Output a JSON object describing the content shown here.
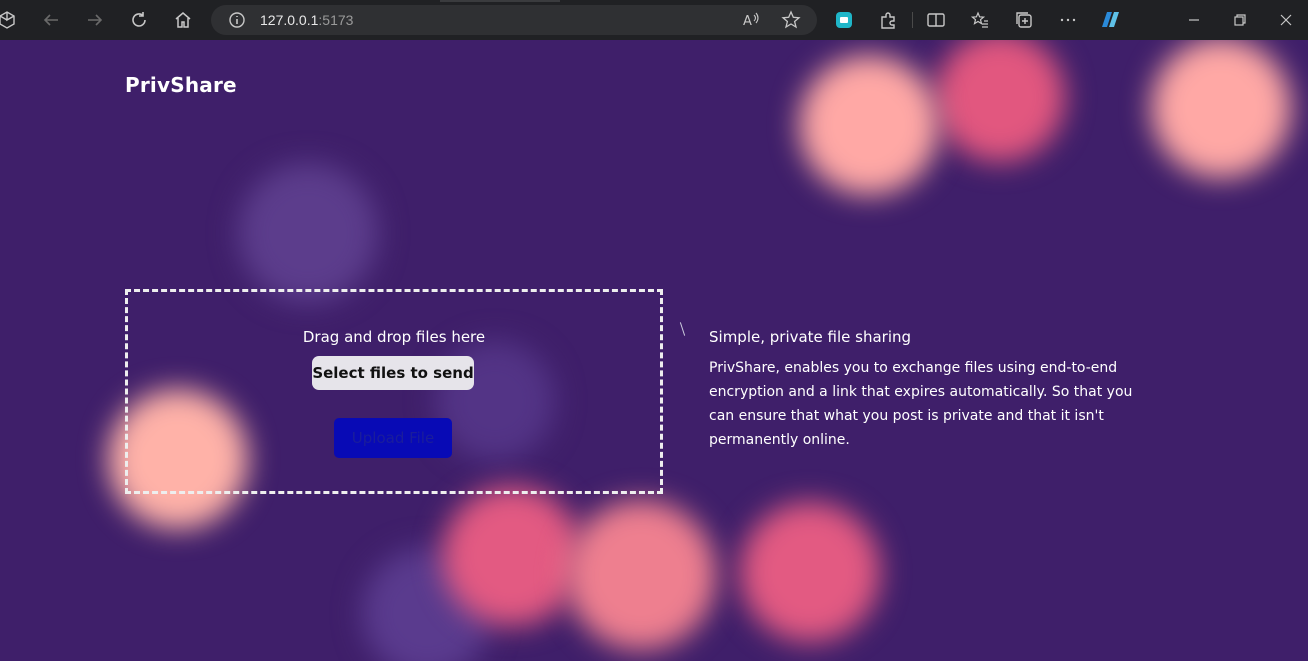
{
  "browser": {
    "url_host": "127.0.0.1",
    "url_port": ":5173"
  },
  "app": {
    "logo": "PrivShare"
  },
  "upload": {
    "drop_label": "Drag and drop files here",
    "select_label": "Select files to send",
    "upload_label": "Upload File"
  },
  "info": {
    "title": "Simple, private file sharing",
    "body": "PrivShare, enables you to exchange files using end-to-end encryption and a link that expires automatically. So that you can ensure that what you post is private and that it isn't permanently online."
  },
  "colors": {
    "background": "#3f1f6a",
    "accent_blob_peach": "#ffb0a8",
    "accent_blob_pink": "#e8607f",
    "upload_button": "#080ab5"
  }
}
